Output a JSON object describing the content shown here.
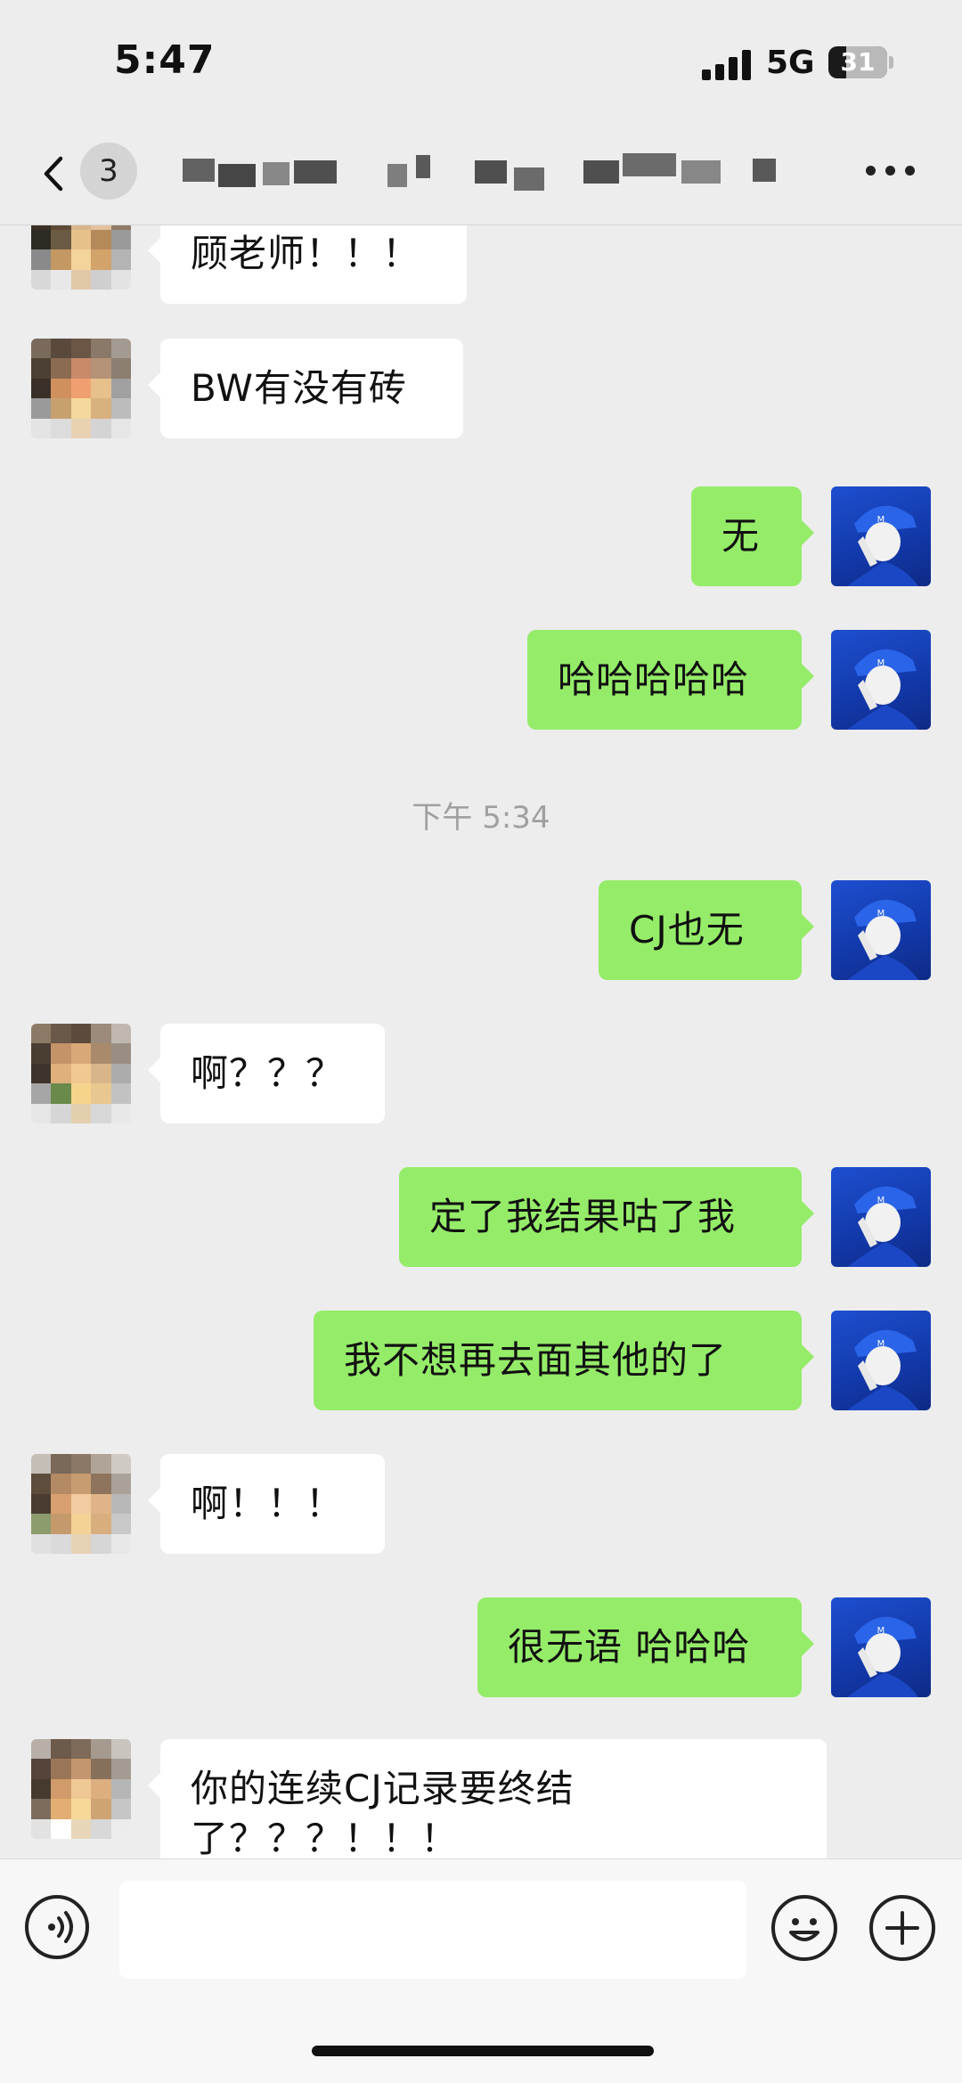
{
  "status_bar": {
    "time": "5:47",
    "network": "5G",
    "battery": "31"
  },
  "nav": {
    "unread_count": "3",
    "title_redacted": true,
    "back_icon": "chevron-left-icon",
    "more_icon": "ellipsis-icon"
  },
  "messages": [
    {
      "side": "in",
      "text": "顾老师！！！"
    },
    {
      "side": "in",
      "text": "BW有没有砖"
    },
    {
      "side": "out",
      "text": "无"
    },
    {
      "side": "out",
      "text": "哈哈哈哈哈"
    },
    {
      "side": "out",
      "text": "CJ也无"
    },
    {
      "side": "in",
      "text": "啊？？？"
    },
    {
      "side": "out",
      "text": "定了我结果咕了我"
    },
    {
      "side": "out",
      "text": "我不想再去面其他的了"
    },
    {
      "side": "in",
      "text": "啊！！！"
    },
    {
      "side": "out",
      "text": "很无语 哈哈哈"
    },
    {
      "side": "in",
      "text": "你的连续CJ记录要终结了？？？！！！"
    }
  ],
  "timestamp": "下午 5:34",
  "input_bar": {
    "voice_icon": "voice-icon",
    "emoji_icon": "emoji-icon",
    "plus_icon": "plus-icon",
    "placeholder": ""
  },
  "colors": {
    "background": "#ededed",
    "bubble_in": "#ffffff",
    "bubble_out": "#95ec69",
    "timestamp_text": "#a0a0a0"
  }
}
